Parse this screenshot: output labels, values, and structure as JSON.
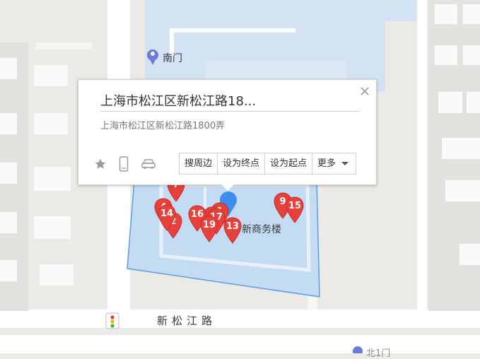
{
  "map": {
    "poi_south_gate": "南门",
    "building_label": "新商务楼",
    "road_label": "新松江路",
    "bottom_right_label": "北1门"
  },
  "markers": [
    {
      "label": "7"
    },
    {
      "label": "4"
    },
    {
      "label": "14"
    },
    {
      "label": "2"
    },
    {
      "label": "16"
    },
    {
      "label": "8"
    },
    {
      "label": "17"
    },
    {
      "label": "1"
    },
    {
      "label": "19"
    },
    {
      "label": "13"
    },
    {
      "label": "9"
    },
    {
      "label": "15"
    }
  ],
  "popup": {
    "title": "上海市松江区新松江路18...",
    "address": "上海市松江区新松江路1800弄",
    "actions": [
      "搜周边",
      "设为终点",
      "设为起点",
      "更多"
    ],
    "icons": [
      "star-icon",
      "phone-icon",
      "car-icon",
      "close-icon",
      "chevron-down-icon"
    ]
  },
  "colors": {
    "marker_red": "#e8403a",
    "current_location_blue": "#3d8ef0",
    "area_fill": "#c3dbf3",
    "area_border": "#5a9ee5"
  }
}
